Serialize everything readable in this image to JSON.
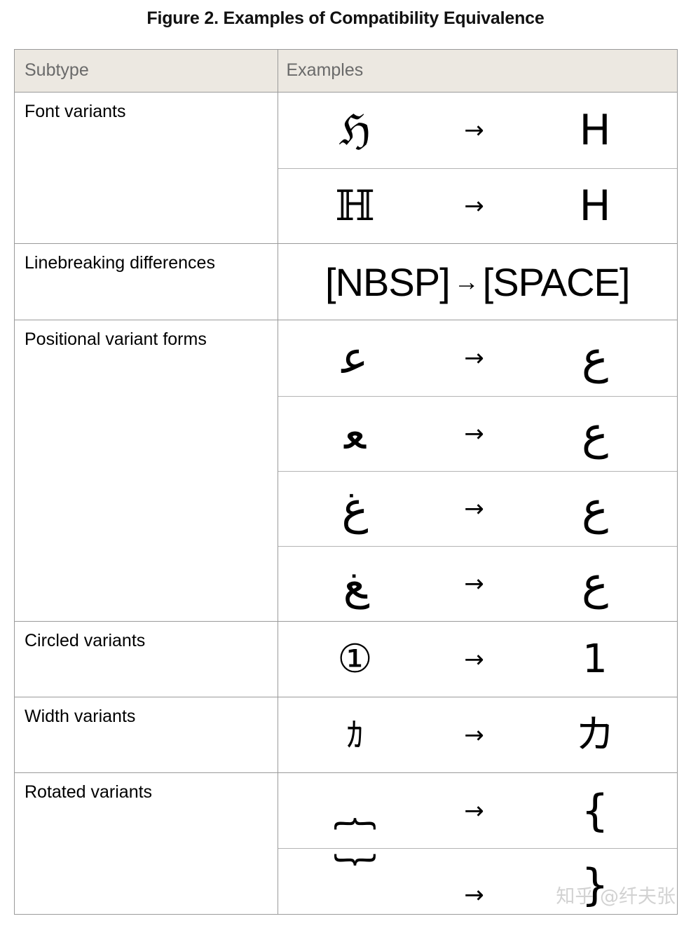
{
  "figure": {
    "title": "Figure 2. Examples of Compatibility Equivalence"
  },
  "table": {
    "columns": [
      "Subtype",
      "Examples"
    ],
    "rows": [
      {
        "subtype": "Font variants",
        "examples": [
          {
            "source": "ℌ",
            "arrow": "→",
            "target": "H"
          },
          {
            "source": "ℍ",
            "arrow": "→",
            "target": "H"
          }
        ]
      },
      {
        "subtype": "Linebreaking differences",
        "wide": {
          "source": "[NBSP]",
          "arrow": "→",
          "target": "[SPACE]"
        },
        "examples": []
      },
      {
        "subtype": "Positional variant forms",
        "examples": [
          {
            "source": "ﻋ",
            "arrow": "→",
            "target": "ع"
          },
          {
            "source": "ﻌ",
            "arrow": "→",
            "target": "ع"
          },
          {
            "source": "ﻍ",
            "arrow": "→",
            "target": "ع"
          },
          {
            "source": "ﻎ",
            "arrow": "→",
            "target": "ع"
          }
        ]
      },
      {
        "subtype": "Circled variants",
        "examples": [
          {
            "source": "①",
            "arrow": "→",
            "target": "1"
          }
        ]
      },
      {
        "subtype": "Width variants",
        "examples": [
          {
            "source": "ｶ",
            "arrow": "→",
            "target": "カ"
          }
        ]
      },
      {
        "subtype": "Rotated variants",
        "examples": [
          {
            "source": "︷",
            "arrow": "→",
            "target": "{"
          },
          {
            "source": "︸",
            "arrow": "→",
            "target": "}"
          }
        ]
      }
    ]
  },
  "watermark": {
    "text": "知乎 @纤夫张"
  },
  "colors": {
    "header_background": "#ece8e1",
    "header_text": "#6a6a6a",
    "border_outer": "#9a9a9a",
    "border_inner": "#b4b4b4",
    "text": "#000000",
    "watermark": "#d2d2d2"
  }
}
